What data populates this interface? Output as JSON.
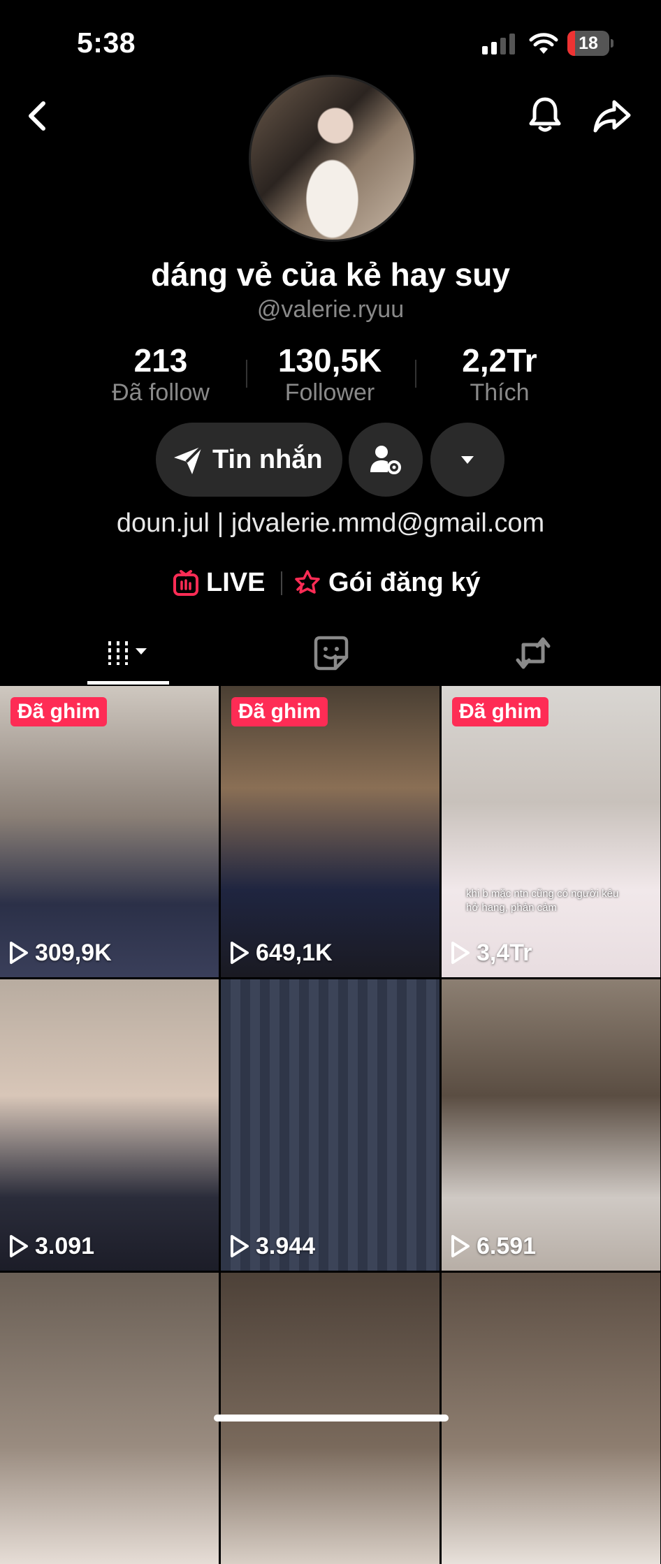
{
  "status_bar": {
    "time": "5:38",
    "battery": 18
  },
  "profile": {
    "display_name": "dáng vẻ của kẻ hay suy",
    "username": "@valerie.ryuu",
    "stats": [
      {
        "value": "213",
        "label": "Đã follow"
      },
      {
        "value": "130,5K",
        "label": "Follower"
      },
      {
        "value": "2,2Tr",
        "label": "Thích"
      }
    ],
    "message_label": "Tin nhắn",
    "bio": "doun.jul | jdvalerie.mmd@gmail.com",
    "live_label": "LIVE",
    "subscription_label": "Gói đăng ký"
  },
  "colors": {
    "accent": "#fe2c55",
    "background": "#000000",
    "button": "#2a2a2a",
    "muted": "#8a8a8a"
  },
  "icons": [
    "back-icon",
    "bell-icon",
    "share-icon",
    "send-icon",
    "person-settings-icon",
    "caret-down-icon",
    "live-icon",
    "subscription-icon",
    "grid-icon",
    "favorites-icon",
    "repost-icon",
    "play-icon"
  ],
  "videos": [
    {
      "pinned_label": "Đã ghim",
      "views": "309,9K"
    },
    {
      "pinned_label": "Đã ghim",
      "views": "649,1K"
    },
    {
      "pinned_label": "Đã ghim",
      "views": "3,4Tr",
      "caption": "khi b mặc ntn cũng có người kêu hở hang, phản cảm"
    },
    {
      "views": "3.091"
    },
    {
      "views": "3.944"
    },
    {
      "views": "6.591"
    },
    {},
    {},
    {}
  ]
}
